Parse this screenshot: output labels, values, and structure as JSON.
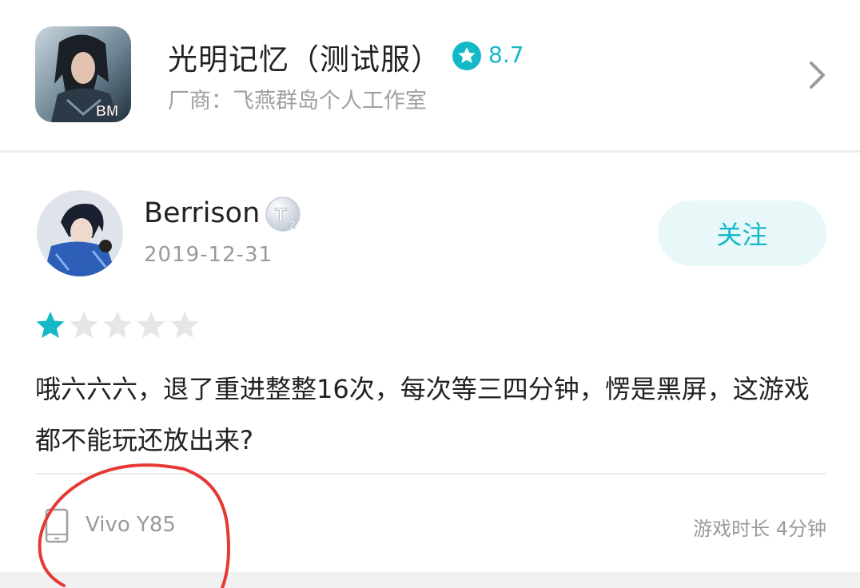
{
  "game": {
    "title": "光明记忆（测试服）",
    "rating": "8.7",
    "vendor": "厂商：飞燕群岛个人工作室",
    "icon_text": "BM"
  },
  "review": {
    "username": "Berrison",
    "level_badge": "T2",
    "date": "2019-12-31",
    "follow_label": "关注",
    "stars": 1,
    "max_stars": 5,
    "text": "哦六六六，退了重进整整16次，每次等三四分钟，愣是黑屏，这游戏都不能玩还放出来?",
    "device": "Vivo Y85",
    "playtime": "游戏时长 4分钟"
  },
  "icons": {
    "rating": "star-badge-icon",
    "chevron": "chevron-right-icon",
    "phone": "phone-icon",
    "level": "level-badge-icon"
  },
  "colors": {
    "accent": "#14b9c8",
    "star_empty": "#e6e6e6",
    "annotation": "#e53935"
  }
}
